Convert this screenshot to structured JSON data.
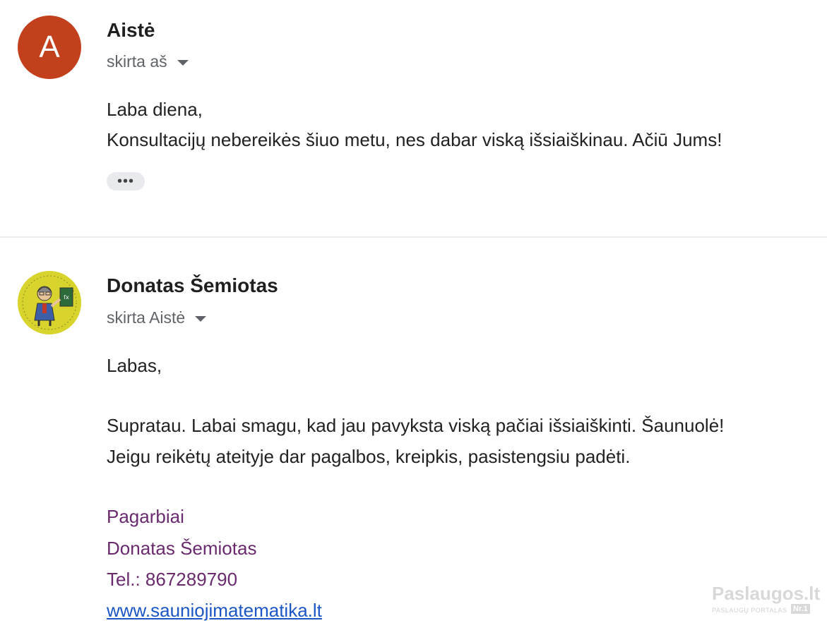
{
  "messages": [
    {
      "avatar_letter": "A",
      "avatar_color": "#c3401d",
      "sender": "Aistė",
      "recipient": "skirta aš",
      "body": [
        "Laba diena,",
        "Konsultacijų nebereikės šiuo metu, nes dabar viską išsiaiškinau. Ačiū Jums!"
      ],
      "more_label": "•••"
    },
    {
      "avatar_icon": "teacher-avatar-image",
      "sender": "Donatas Šemiotas",
      "recipient": "skirta Aistė",
      "body": [
        "Labas,",
        "Supratau. Labai smagu, kad jau pavyksta viską pačiai išsiaiškinti. Šaunuolė!",
        "Jeigu reikėtų ateityje dar pagalbos, kreipkis, pasistengsiu padėti."
      ],
      "signature": {
        "closing": "Pagarbiai",
        "name": "Donatas Šemiotas",
        "phone": "Tel.: 867289790",
        "website": "www.sauniojimatematika.lt"
      }
    }
  ],
  "watermark": {
    "name": "Paslaugos.lt",
    "subtitle": "PASLAUGŲ PORTALAS",
    "badge": "Nr.1"
  }
}
